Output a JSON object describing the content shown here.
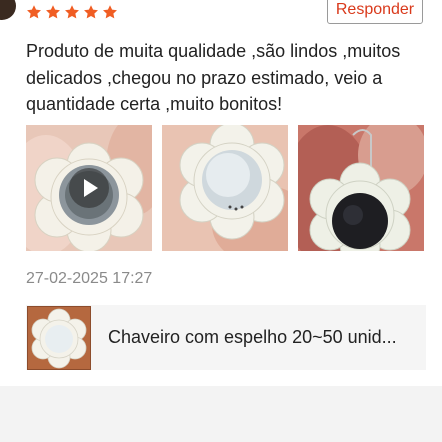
{
  "review": {
    "rating": 5,
    "max_rating": 5,
    "reply_label": "Responder",
    "text": "Produto de muita qualidade ,são lindos ,muitos delicados ,chegou no prazo estimado, veio a quantidade certa ,muito bonitos!",
    "date": "27-02-2025 17:27",
    "star_color": "#f05d23",
    "accent_color": "#d9391b"
  },
  "media": [
    {
      "type": "video",
      "icon": "play-icon"
    },
    {
      "type": "image"
    },
    {
      "type": "image"
    }
  ],
  "product": {
    "title": "Chaveiro com espelho 20~50 unid..."
  }
}
